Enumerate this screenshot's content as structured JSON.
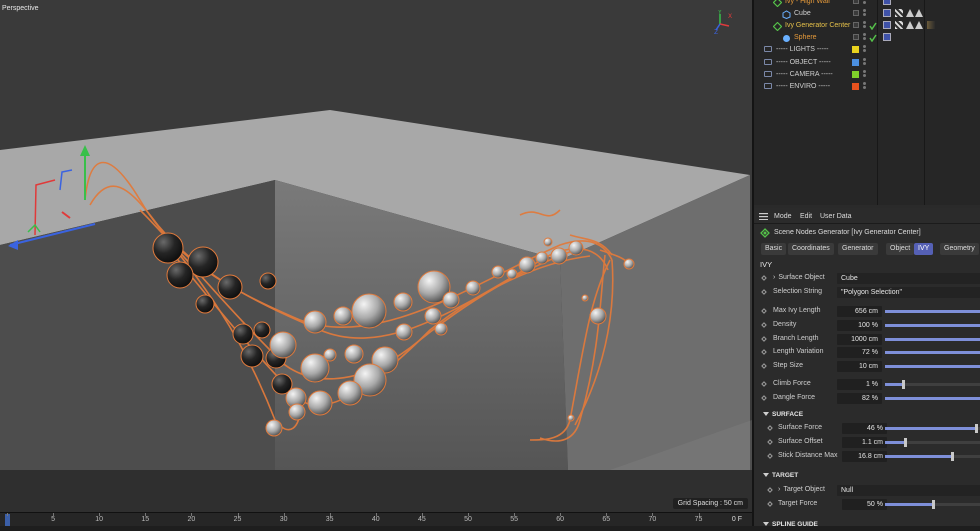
{
  "viewport": {
    "label": "Perspective",
    "grid_spacing": "Grid Spacing : 50 cm",
    "gizmo_axes": {
      "x": "X",
      "y": "Y",
      "z": "Z"
    }
  },
  "timeline": {
    "ticks": [
      "0",
      "5",
      "10",
      "15",
      "20",
      "25",
      "30",
      "35",
      "40",
      "45",
      "50",
      "55",
      "60",
      "65",
      "70",
      "75"
    ],
    "current_frame": "0 F"
  },
  "object_manager": {
    "rows": [
      {
        "name": "Ivy - High Wall",
        "color": "#e69a3a",
        "indent": 1
      },
      {
        "name": "Cube",
        "color": "#cfcfcf",
        "indent": 2
      },
      {
        "name": "Ivy Generator Center",
        "color": "#e6c14a",
        "indent": 1
      },
      {
        "name": "Sphere",
        "color": "#e69a3a",
        "indent": 2
      },
      {
        "name": "----- LIGHTS -----",
        "color": "#cfcfcf",
        "indent": 0,
        "swatch": "#e8d21e"
      },
      {
        "name": "----- OBJECT -----",
        "color": "#cfcfcf",
        "indent": 0,
        "swatch": "#4b8fe0"
      },
      {
        "name": "----- CAMERA -----",
        "color": "#cfcfcf",
        "indent": 0,
        "swatch": "#7fd02a"
      },
      {
        "name": "----- ENVIRO -----",
        "color": "#cfcfcf",
        "indent": 0,
        "swatch": "#e8521e"
      }
    ]
  },
  "attribute_manager": {
    "menu": [
      "Mode",
      "Edit",
      "User Data"
    ],
    "title": "Scene Nodes Generator [Ivy Generator Center]",
    "tabs": [
      "Basic",
      "Coordinates",
      "Generator",
      "Object",
      "IVY",
      "Geometry"
    ],
    "active_tab": "IVY",
    "section_title": "IVY",
    "surface_object": {
      "label": "Surface Object",
      "value": "Cube"
    },
    "selection_string": {
      "label": "Selection String",
      "value": "\"Polygon Selection\""
    },
    "params": [
      {
        "label": "Max Ivy Length",
        "value": "656 cm",
        "fill": 1.0
      },
      {
        "label": "Density",
        "value": "100 %",
        "fill": 1.0
      },
      {
        "label": "Branch Length",
        "value": "1000 cm",
        "fill": 1.0
      },
      {
        "label": "Length Variation",
        "value": "72 %",
        "fill": 1.0
      },
      {
        "label": "Step Size",
        "value": "10 cm",
        "fill": 1.0
      }
    ],
    "forces": [
      {
        "label": "Climb Force",
        "value": "1 %",
        "fill": 0.2
      },
      {
        "label": "Dangle Force",
        "value": "82 %",
        "fill": 1.0
      }
    ],
    "surface": {
      "title": "SURFACE",
      "params": [
        {
          "label": "Surface Force",
          "value": "46 %",
          "fill": 0.95
        },
        {
          "label": "Surface Offset",
          "value": "1.1 cm",
          "fill": 0.22
        },
        {
          "label": "Stick Distance Max",
          "value": "16.8 cm",
          "fill": 0.7
        }
      ]
    },
    "target": {
      "title": "TARGET",
      "object": {
        "label": "Target Object",
        "value": "Null"
      },
      "force": {
        "label": "Target Force",
        "value": "50 %",
        "fill": 0.5
      }
    },
    "next_section": "SPLINE GUIDE"
  }
}
